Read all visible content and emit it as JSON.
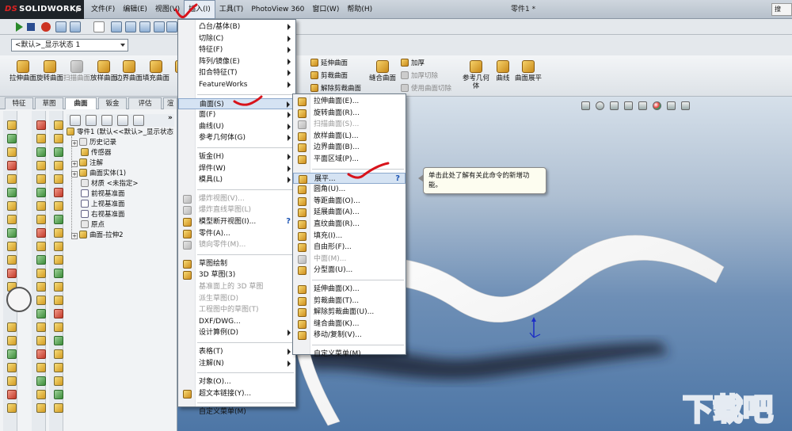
{
  "app": {
    "logo": "SOLIDWORKS",
    "logo_prefix": "DS",
    "doc_title": "零件1 *",
    "help_frag": "搜"
  },
  "menubar": [
    {
      "label": "文件(F)"
    },
    {
      "label": "编辑(E)"
    },
    {
      "label": "视图(V)"
    },
    {
      "label": "插入(I)",
      "active": true
    },
    {
      "label": "工具(T)"
    },
    {
      "label": "PhotoView 360"
    },
    {
      "label": "窗口(W)"
    },
    {
      "label": "帮助(H)"
    }
  ],
  "display_state": "<默认>_显示状态 1",
  "command_manager": {
    "buttons": [
      {
        "label": "拉伸曲面"
      },
      {
        "label": "旋转曲面"
      },
      {
        "label": "扫描曲面",
        "dim": true
      },
      {
        "label": "放样曲面"
      },
      {
        "label": "边界曲面"
      },
      {
        "label": "填充曲面"
      },
      {
        "label": "自"
      },
      {
        "label": "缝合曲面"
      },
      {
        "label": "参考几何体"
      },
      {
        "label": "曲线"
      },
      {
        "label": "曲面展平"
      }
    ],
    "rows": [
      {
        "label": "延伸曲面"
      },
      {
        "label": "剪裁曲面"
      },
      {
        "label": "解除剪裁曲面"
      },
      {
        "label": "加厚"
      },
      {
        "label": "加厚切除",
        "dim": true
      },
      {
        "label": "使用曲面切除",
        "dim": true
      }
    ]
  },
  "tabs": [
    {
      "label": "特征"
    },
    {
      "label": "草图"
    },
    {
      "label": "曲面",
      "active": true
    },
    {
      "label": "钣金"
    },
    {
      "label": "评估"
    },
    {
      "label": "渲"
    }
  ],
  "feature_tree": {
    "more": "»",
    "items": [
      {
        "label": "零件1 (默认<<默认>_显示状态",
        "icon": "part",
        "exp": ""
      },
      {
        "label": "历史记录",
        "icon": "g",
        "exp": "+"
      },
      {
        "label": "传感器",
        "icon": "y",
        "exp": ""
      },
      {
        "label": "注解",
        "icon": "y",
        "exp": "+"
      },
      {
        "label": "曲面实体(1)",
        "icon": "y",
        "exp": "+"
      },
      {
        "label": "材质 <未指定>",
        "icon": "g",
        "exp": ""
      },
      {
        "label": "前视基准面",
        "icon": "p",
        "exp": ""
      },
      {
        "label": "上视基准面",
        "icon": "p",
        "exp": ""
      },
      {
        "label": "右视基准面",
        "icon": "p",
        "exp": ""
      },
      {
        "label": "原点",
        "icon": "g",
        "exp": ""
      },
      {
        "label": "曲面-拉伸2",
        "icon": "y",
        "exp": "+"
      }
    ]
  },
  "insert_menu": [
    {
      "label": "凸台/基体(B)",
      "sub": true
    },
    {
      "label": "切除(C)",
      "sub": true
    },
    {
      "label": "特征(F)",
      "sub": true
    },
    {
      "label": "阵列/镜像(E)",
      "sub": true
    },
    {
      "label": "扣合特征(T)",
      "sub": true
    },
    {
      "label": "FeatureWorks",
      "sub": true
    },
    {
      "sep": true
    },
    {
      "label": "曲面(S)",
      "sub": true,
      "hl": true
    },
    {
      "label": "面(F)",
      "sub": true
    },
    {
      "label": "曲线(U)",
      "sub": true
    },
    {
      "label": "参考几何体(G)",
      "sub": true
    },
    {
      "sep": true
    },
    {
      "label": "钣金(H)",
      "sub": true
    },
    {
      "label": "焊件(W)",
      "sub": true
    },
    {
      "label": "模具(L)",
      "sub": true
    },
    {
      "sep": true
    },
    {
      "label": "爆炸视图(V)...",
      "icon": true,
      "dim": true
    },
    {
      "label": "爆炸直线草图(L)",
      "icon": true,
      "dim": true
    },
    {
      "label": "模型断开视图(I)...",
      "icon": true,
      "help": true
    },
    {
      "label": "零件(A)...",
      "icon": true
    },
    {
      "label": "镜向零件(M)...",
      "icon": true,
      "dim": true
    },
    {
      "sep": true
    },
    {
      "label": "草图绘制",
      "icon": true
    },
    {
      "label": "3D 草图(3)",
      "icon": true
    },
    {
      "label": "基准面上的 3D 草图",
      "dim": true
    },
    {
      "label": "派生草图(D)",
      "dim": true
    },
    {
      "label": "工程图中的草图(T)",
      "dim": true
    },
    {
      "label": "DXF/DWG..."
    },
    {
      "label": "设计算例(D)",
      "sub": true
    },
    {
      "sep": true
    },
    {
      "label": "表格(T)",
      "sub": true
    },
    {
      "label": "注解(N)",
      "sub": true
    },
    {
      "sep": true
    },
    {
      "label": "对象(O)..."
    },
    {
      "label": "超文本链接(Y)...",
      "icon": true
    },
    {
      "sep": true
    },
    {
      "label": "自定义菜单(M)"
    }
  ],
  "surface_menu": [
    {
      "label": "拉伸曲面(E)...",
      "icon": true
    },
    {
      "label": "旋转曲面(R)...",
      "icon": true
    },
    {
      "label": "扫描曲面(S)...",
      "icon": true,
      "dim": true
    },
    {
      "label": "放样曲面(L)...",
      "icon": true
    },
    {
      "label": "边界曲面(B)...",
      "icon": true
    },
    {
      "label": "平面区域(P)...",
      "icon": true
    },
    {
      "sep": true
    },
    {
      "label": "展平...",
      "icon": true,
      "hl": true,
      "help": true
    },
    {
      "label": "圆角(U)...",
      "icon": true
    },
    {
      "label": "等距曲面(O)...",
      "icon": true
    },
    {
      "label": "延展曲面(A)...",
      "icon": true
    },
    {
      "label": "直纹曲面(R)...",
      "icon": true
    },
    {
      "label": "填充(I)...",
      "icon": true
    },
    {
      "label": "自由形(F)...",
      "icon": true
    },
    {
      "label": "中面(M)...",
      "icon": true,
      "dim": true
    },
    {
      "label": "分型面(U)...",
      "icon": true
    },
    {
      "sep": true
    },
    {
      "label": "延伸曲面(X)...",
      "icon": true
    },
    {
      "label": "剪裁曲面(T)...",
      "icon": true
    },
    {
      "label": "解除剪裁曲面(U)...",
      "icon": true
    },
    {
      "label": "缝合曲面(K)...",
      "icon": true
    },
    {
      "label": "移动/复制(V)...",
      "icon": true
    },
    {
      "sep": true
    },
    {
      "label": "自定义菜单(M)"
    }
  ],
  "tooltip": "单击此处了解有关此命令的新增功能。",
  "watermark": "下载吧",
  "colors": {
    "annotation_red": "#d8131b",
    "menu_highlight": "#d5e3f3"
  }
}
